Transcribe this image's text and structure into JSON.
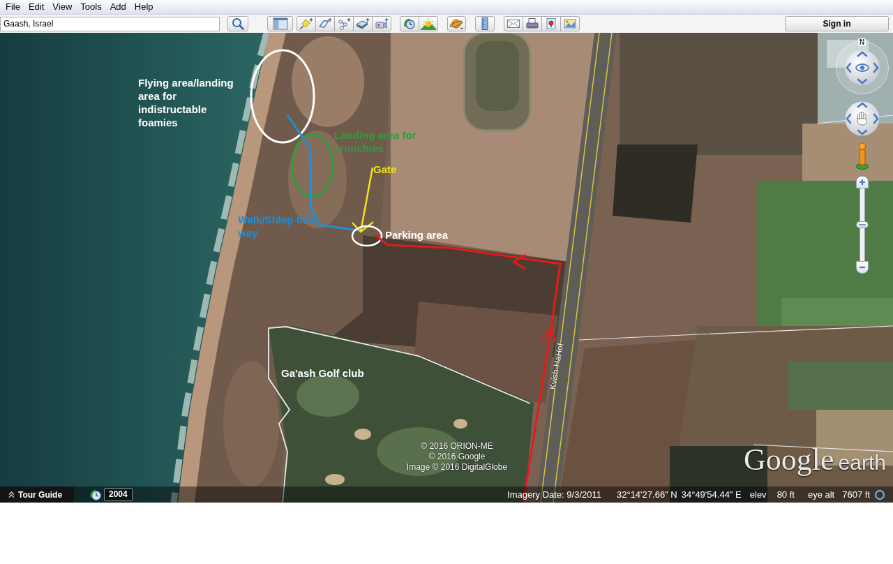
{
  "menu_bar": [
    "File",
    "Edit",
    "View",
    "Tools",
    "Add",
    "Help"
  ],
  "toolbar": {
    "search": {
      "value": "Gaash, Israel"
    },
    "sign_in": "Sign in"
  },
  "map": {
    "labels": [
      {
        "text": "Flying area/landing area for indistructable foamies",
        "color": "#ffffff"
      },
      {
        "text": "Landing area for crunchies",
        "color": "#2e9e3c"
      },
      {
        "text": "Gate",
        "color": "#f2e21a"
      },
      {
        "text": "Walk/Shlep this way",
        "color": "#1f8fd6"
      },
      {
        "text": "Parking area",
        "color": "#ffffff"
      },
      {
        "text": "Ga'ash Golf club",
        "color": "#ffffff"
      }
    ],
    "road_label": "Kvish-HaHof",
    "compass": "N",
    "zoom_slider": {
      "level": 0.5
    },
    "attribution": [
      "© 2016 ORION-ME",
      "© 2016 Google",
      "Image © 2016 DigitalGlobe"
    ],
    "logo": {
      "brand": "Google",
      "product": "earth"
    }
  },
  "bottom_bar": {
    "tour_guide": "Tour Guide",
    "historical_year": "2004",
    "imagery_date": "Imagery Date: 9/3/2011",
    "latitude": "32°14'27.66\" N",
    "longitude": "34°49'54.44\" E",
    "elevation_label": "elev",
    "elevation": "80 ft",
    "eye_alt_label": "eye alt",
    "eye_alt": "7607 ft"
  }
}
